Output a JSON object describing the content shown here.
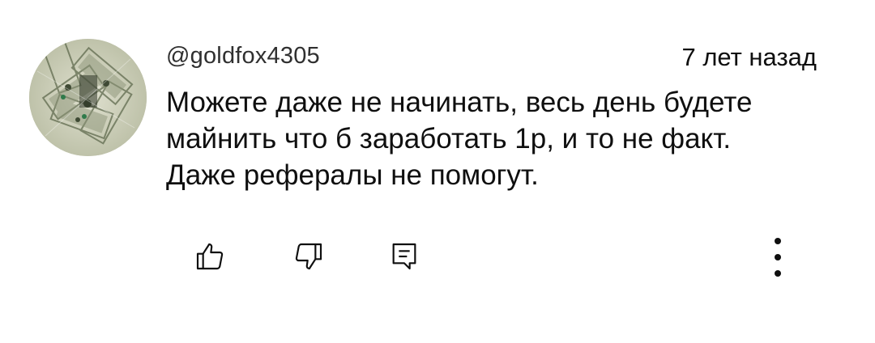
{
  "comment": {
    "author": "@goldfox4305",
    "timestamp": "7 лет назад",
    "text_lines": [
      "Можете даже не начинать, весь день будете",
      "майнить что б заработать 1р, и то не факт.",
      "Даже рефералы не помогут."
    ],
    "avatar_icon": "money-avatar-icon"
  },
  "actions": {
    "like_icon": "thumb-up-icon",
    "dislike_icon": "thumb-down-icon",
    "reply_icon": "reply-comment-icon",
    "more_icon": "more-vertical-icon"
  }
}
